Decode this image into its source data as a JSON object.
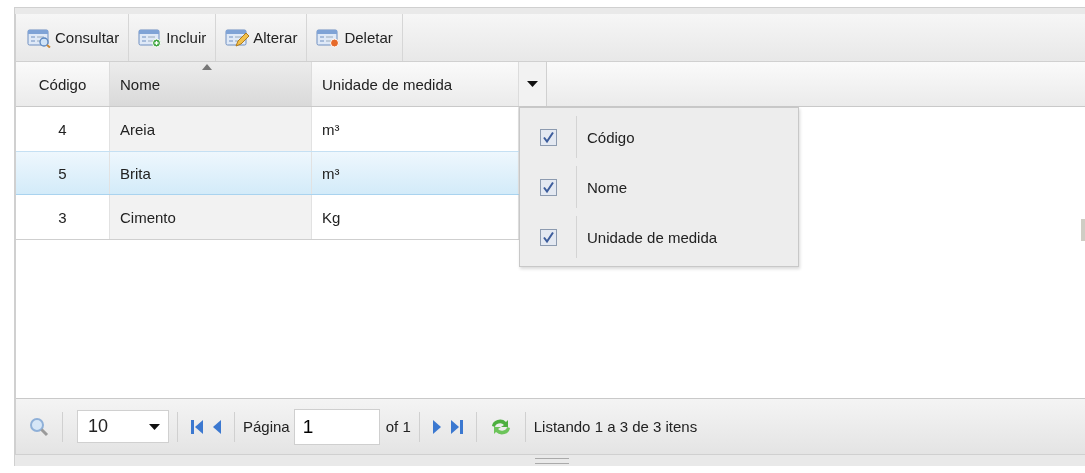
{
  "toolbar": [
    {
      "label": "Consultar",
      "kind": "query"
    },
    {
      "label": "Incluir",
      "kind": "add"
    },
    {
      "label": "Alterar",
      "kind": "edit"
    },
    {
      "label": "Deletar",
      "kind": "delete"
    }
  ],
  "grid": {
    "columns": [
      {
        "label": "Código",
        "kind": "number",
        "sorted": false
      },
      {
        "label": "Nome",
        "kind": "text",
        "sorted": true
      },
      {
        "label": "Unidade de medida",
        "kind": "text",
        "sorted": false
      }
    ],
    "rows": [
      {
        "cells": [
          "4",
          "Areia",
          "m³"
        ],
        "selected": false
      },
      {
        "cells": [
          "5",
          "Brita",
          "m³"
        ],
        "selected": true
      },
      {
        "cells": [
          "3",
          "Cimento",
          "Kg"
        ],
        "selected": false
      }
    ],
    "column_menu": [
      {
        "label": "Código",
        "checked": true
      },
      {
        "label": "Nome",
        "checked": true
      },
      {
        "label": "Unidade de medida",
        "checked": true
      }
    ]
  },
  "pager": {
    "page_size": "10",
    "page_label": "Página",
    "page": "1",
    "page_count": "of 1",
    "status": "Listando 1 a 3 de 3 itens"
  }
}
